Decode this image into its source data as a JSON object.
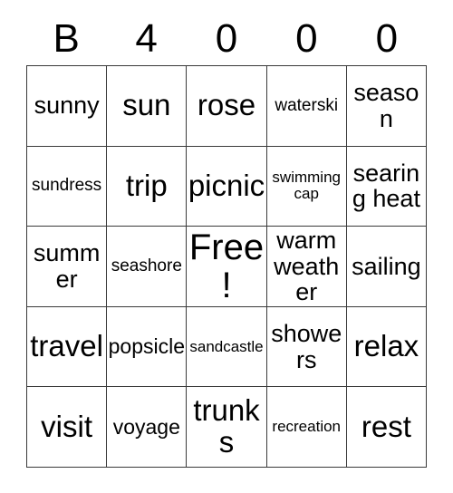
{
  "card": {
    "header": {
      "letters": [
        "B",
        "4",
        "0",
        "0",
        "0"
      ]
    },
    "columns": 5,
    "rows": 5,
    "colors": {
      "background": "#ffffff",
      "text": "#000000",
      "border": "#3a3a3a"
    },
    "free_space": {
      "label": "Free!",
      "row": 3,
      "column": 3
    },
    "grid": [
      [
        {
          "text": "sunny",
          "size": "fs-md"
        },
        {
          "text": "sun",
          "size": "fs-lg"
        },
        {
          "text": "rose",
          "size": "fs-lg"
        },
        {
          "text": "waterski",
          "size": "fs-xs"
        },
        {
          "text": "season",
          "size": "fs-md"
        }
      ],
      [
        {
          "text": "sundress",
          "size": "fs-xs"
        },
        {
          "text": "trip",
          "size": "fs-lg"
        },
        {
          "text": "picnic",
          "size": "fs-lg"
        },
        {
          "text": "swimming cap",
          "size": "fs-xxs"
        },
        {
          "text": "searing heat",
          "size": "fs-md"
        }
      ],
      [
        {
          "text": "summer",
          "size": "fs-md"
        },
        {
          "text": "seashore",
          "size": "fs-xs"
        },
        {
          "text": "Free!",
          "size": "fs-xl"
        },
        {
          "text": "warm weather",
          "size": "fs-md"
        },
        {
          "text": "sailing",
          "size": "fs-md"
        }
      ],
      [
        {
          "text": "travel",
          "size": "fs-lg"
        },
        {
          "text": "popsicle",
          "size": "fs-sm"
        },
        {
          "text": "sandcastle",
          "size": "fs-xxs"
        },
        {
          "text": "showers",
          "size": "fs-md"
        },
        {
          "text": "relax",
          "size": "fs-lg"
        }
      ],
      [
        {
          "text": "visit",
          "size": "fs-lg"
        },
        {
          "text": "voyage",
          "size": "fs-sm"
        },
        {
          "text": "trunks",
          "size": "fs-lg"
        },
        {
          "text": "recreation",
          "size": "fs-xxs"
        },
        {
          "text": "rest",
          "size": "fs-lg"
        }
      ]
    ]
  }
}
